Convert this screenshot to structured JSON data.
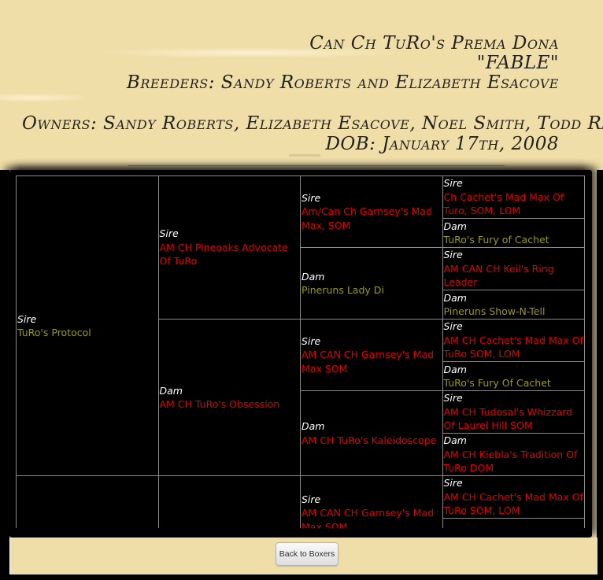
{
  "header": {
    "title": "Can Ch TuRo's Prema Dona",
    "nickname": "\"FABLE\"",
    "breeders": "Breeders: Sandy Roberts and Elizabeth Esacove",
    "owners": "Owners: Sandy Roberts, Elizabeth Esacove, Noel Smith, Todd Rasor",
    "dob": "DOB:  January 17th, 2008"
  },
  "colors": {
    "background": "#f0dea8",
    "table_bg": "#000000",
    "champion_name": "#e00000",
    "non_champion_name": "#9a9a10",
    "role_label": "#ffffff"
  },
  "pedigree": {
    "sire": {
      "role": "Sire",
      "name": "TuRo's Protocol",
      "style": "olive",
      "sire": {
        "role": "Sire",
        "name": "AM CH Pineoaks Advocate Of TuRo",
        "style": "red",
        "sire": {
          "role": "Sire",
          "name": "Am/Can Ch Garnsey's Mad Max, SOM",
          "style": "red",
          "sire": {
            "role": "Sire",
            "name": "Ch Cachet's Mad Max Of Turo, SOM, LOM",
            "style": "red"
          },
          "dam": {
            "role": "Dam",
            "name": "TuRo's Fury of Cachet",
            "style": "olive"
          }
        },
        "dam": {
          "role": "Dam",
          "name": "Pineruns Lady Di",
          "style": "olive",
          "sire": {
            "role": "Sire",
            "name": "AM CAN CH Keil's Ring Leader",
            "style": "red"
          },
          "dam": {
            "role": "Dam",
            "name": "Pineruns Show-N-Tell",
            "style": "olive"
          }
        }
      },
      "dam": {
        "role": "Dam",
        "name": "AM CH TuRo's Obsession",
        "style": "red",
        "sire": {
          "role": "Sire",
          "name": "AM CAN CH Garnsey's Mad Max SOM",
          "style": "red",
          "sire": {
            "role": "Sire",
            "name": "AM CH Cachet's Mad Max Of TuRo SOM, LOM",
            "style": "red"
          },
          "dam": {
            "role": "Dam",
            "name": "TuRo's Fury Of Cachet",
            "style": "olive"
          }
        },
        "dam": {
          "role": "Dam",
          "name": "AM CH TuRo's Kaleidoscope",
          "style": "red",
          "sire": {
            "role": "Sire",
            "name": "AM CH Tudosal's Whizzard Of Laurel Hill SOM",
            "style": "red"
          },
          "dam": {
            "role": "Dam",
            "name": "AM CH Kiebla's Tradition Of TuRo DOM",
            "style": "red"
          }
        }
      }
    },
    "dam_partial": {
      "sire_sire": {
        "role": "Sire",
        "name": "AM CAN CH Garnsey's Mad Max SOM",
        "style": "red",
        "sire": {
          "role": "Sire",
          "name": "AM CH Cachet's Mad Max Of TuRo SOM, LOM",
          "style": "red"
        }
      }
    }
  },
  "footer": {
    "back_button": "Back to Boxers"
  }
}
